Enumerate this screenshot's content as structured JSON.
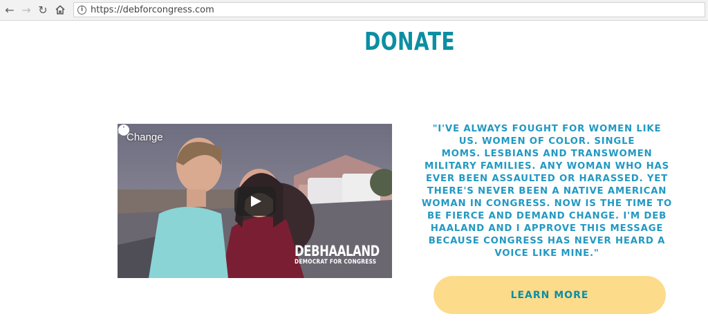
{
  "browser": {
    "url": "https://debforcongress.com",
    "back_icon": "arrow-left-icon",
    "forward_icon": "arrow-right-icon",
    "reload_icon": "reload-icon",
    "home_icon": "home-icon",
    "info_icon": "info-icon"
  },
  "page": {
    "heading": "DONATE",
    "video": {
      "title": "Change",
      "logo_name": "DEBHAALAND",
      "logo_subtitle": "DEMOCRAT FOR CONGRESS"
    },
    "quote": "\"I'VE ALWAYS FOUGHT FOR WOMEN LIKE\nUS. WOMEN OF COLOR. SINGLE\nMOMS. LESBIANS AND TRANSWOMEN\nMILITARY FAMILIES. ANY WOMAN WHO HAS\nEVER BEEN ASSAULTED OR HARASSED. YET\nTHERE'S NEVER BEEN A NATIVE AMERICAN\nWOMAN IN CONGRESS. NOW IS THE TIME TO\nBE FIERCE AND DEMAND CHANGE.  I'M DEB\nHAALAND AND I APPROVE THIS MESSAGE\nBECAUSE CONGRESS HAS NEVER HEARD A\nVOICE LIKE MINE.\"",
    "cta_label": "LEARN MORE"
  },
  "colors": {
    "accent_teal": "#0c8ea2",
    "quote_blue": "#2299c2",
    "button_yellow": "#fcdb8b"
  }
}
